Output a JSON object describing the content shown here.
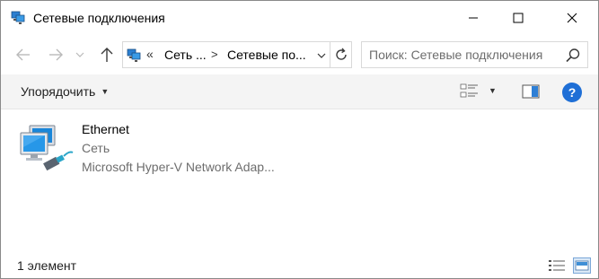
{
  "window": {
    "title": "Сетевые подключения"
  },
  "navigation": {
    "breadcrumb_overflow": "«",
    "breadcrumbs": [
      "Сеть ...",
      "Сетевые по..."
    ],
    "crumb_separator": ">"
  },
  "search": {
    "placeholder": "Поиск: Сетевые подключения"
  },
  "command_bar": {
    "organize_label": "Упорядочить",
    "help_label": "?"
  },
  "items": [
    {
      "name": "Ethernet",
      "type": "Сеть",
      "device": "Microsoft Hyper-V Network Adap..."
    }
  ],
  "status": {
    "count_text": "1 элемент"
  },
  "colors": {
    "accent": "#1f6fd6",
    "command_bar_bg": "#f4f4f4",
    "secondary_text": "#6d6d6d"
  }
}
